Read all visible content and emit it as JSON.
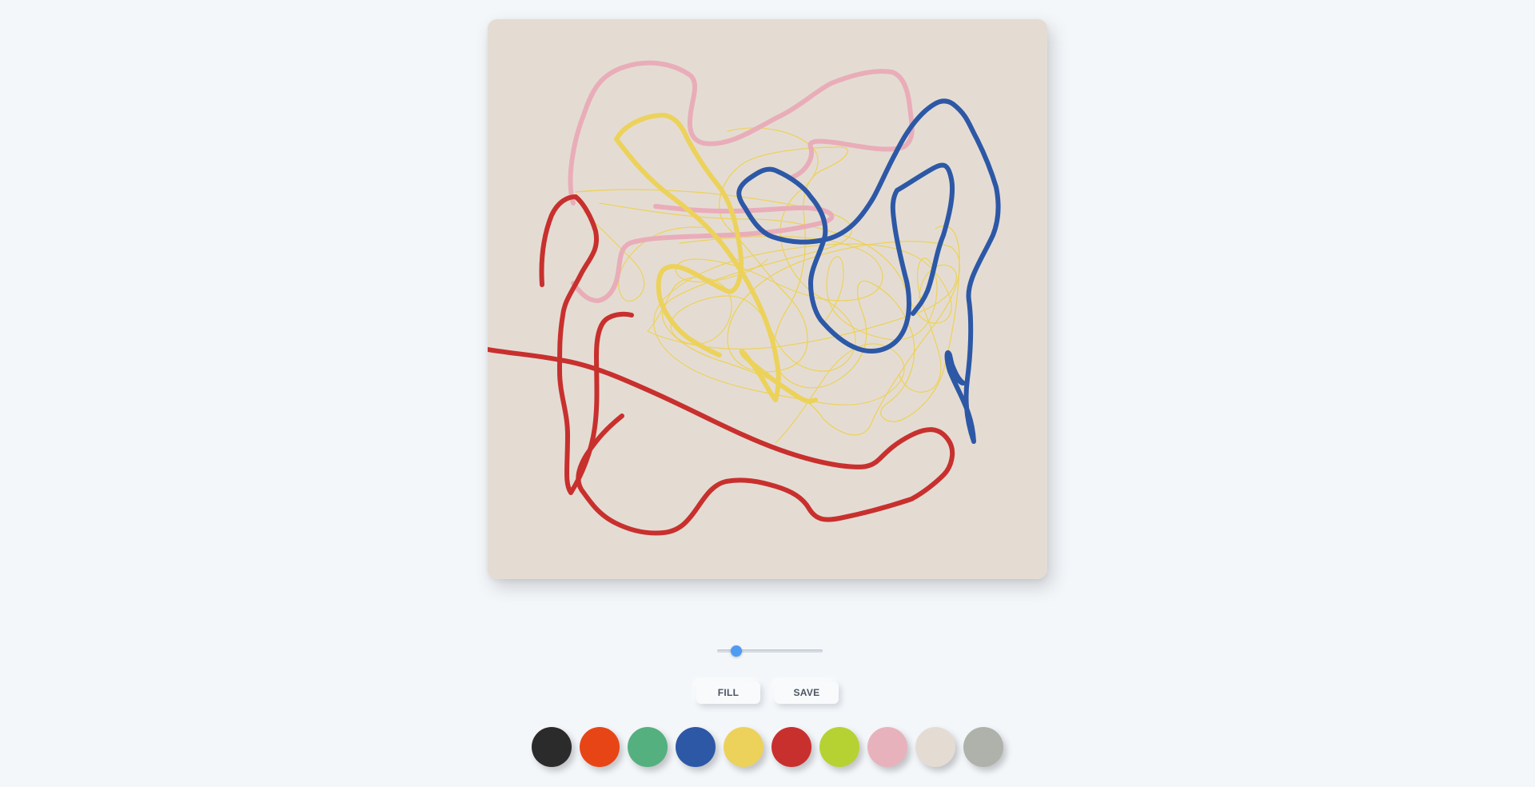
{
  "canvas": {
    "background": "#e4dcd3"
  },
  "brush_size_slider": {
    "value_fraction": 0.14
  },
  "buttons": {
    "fill_label": "FILL",
    "save_label": "SAVE"
  },
  "palette": [
    {
      "name": "black",
      "color": "#2b2b2b"
    },
    {
      "name": "orange-red",
      "color": "#e84516"
    },
    {
      "name": "green",
      "color": "#55b07f"
    },
    {
      "name": "blue",
      "color": "#2d58a6"
    },
    {
      "name": "yellow",
      "color": "#ecd25b"
    },
    {
      "name": "red",
      "color": "#c8302e"
    },
    {
      "name": "lime",
      "color": "#b6d232"
    },
    {
      "name": "pink",
      "color": "#e8b2bc"
    },
    {
      "name": "beige",
      "color": "#e4dcd3"
    },
    {
      "name": "gray",
      "color": "#aeb2aa"
    }
  ],
  "strokes": {
    "pink": "#e9adb9",
    "yellow": "#ecd25b",
    "blue": "#2d58a6",
    "red": "#c8302e"
  }
}
